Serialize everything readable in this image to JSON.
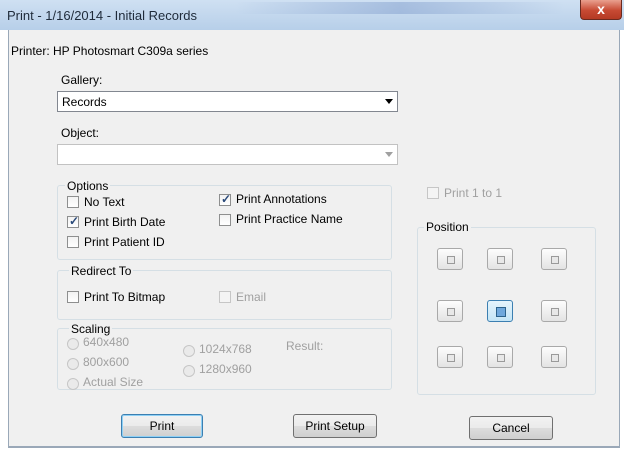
{
  "window": {
    "title": "Print - 1/16/2014 - Initial Records",
    "close_label": "x"
  },
  "printer_label": "Printer: HP Photosmart C309a series",
  "gallery": {
    "label": "Gallery:",
    "value": "Records"
  },
  "object": {
    "label": "Object:",
    "value": ""
  },
  "options": {
    "label": "Options",
    "no_text": {
      "label": "No Text",
      "checked": false
    },
    "print_birth_date": {
      "label": "Print Birth Date",
      "checked": true
    },
    "print_patient_id": {
      "label": "Print Patient ID",
      "checked": false
    },
    "print_annotations": {
      "label": "Print Annotations",
      "checked": true
    },
    "print_practice_name": {
      "label": "Print Practice Name",
      "checked": false
    }
  },
  "redirect": {
    "label": "Redirect To",
    "print_to_bitmap": {
      "label": "Print To Bitmap",
      "checked": false
    },
    "email": {
      "label": "Email",
      "checked": false
    }
  },
  "scaling": {
    "label": "Scaling",
    "opt_640": "640x480",
    "opt_800": "800x600",
    "opt_actual": "Actual Size",
    "opt_1024": "1024x768",
    "opt_1280": "1280x960",
    "result_label": "Result:"
  },
  "print_1_to_1": {
    "label": "Print 1 to 1",
    "checked": false
  },
  "position": {
    "label": "Position",
    "selected": "middle-center"
  },
  "buttons": {
    "print": "Print",
    "print_setup": "Print Setup",
    "cancel": "Cancel"
  },
  "colors": {
    "title_text": "#1f2b3a",
    "close": "#c74a33",
    "disabled_text": "#a0a0a0"
  }
}
